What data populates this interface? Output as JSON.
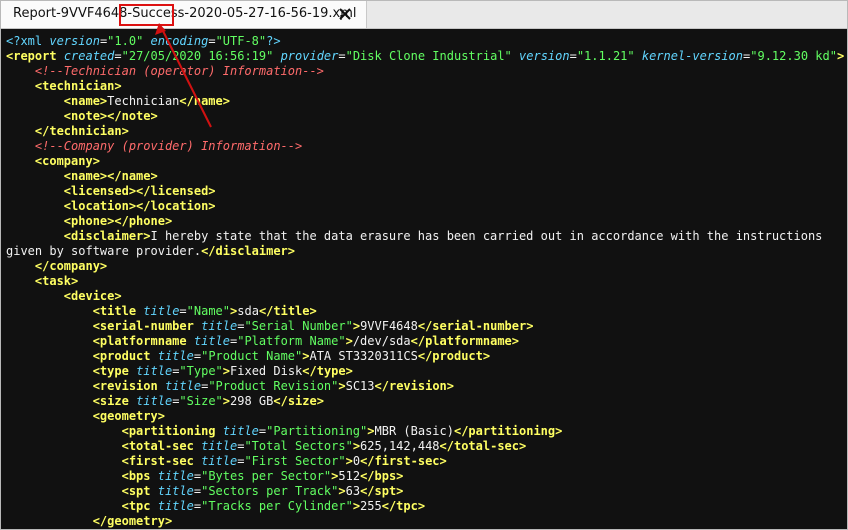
{
  "tab": {
    "title": "Report-9VVF4648-Success-2020-05-27-16-56-19.xml"
  },
  "editor": {
    "l1": {
      "open": "<?xml",
      "a1": "version",
      "v1": "\"1.0\"",
      "a2": "encoding",
      "v2": "\"UTF-8\"",
      "close": "?>"
    },
    "l2": {
      "open": "<report",
      "a1": "created",
      "v1": "\"27/05/2020 16:56:19\"",
      "a2": "provider",
      "v2": "\"Disk Clone Industrial\"",
      "a3": "version",
      "v3": "\"1.1.21\"",
      "a4": "kernel-version",
      "v4": "\"9.12.30 kd\"",
      "close": ">"
    },
    "l3": {
      "comment": "<!--Technician (operator) Information-->"
    },
    "l4": {
      "tag": "<technician>"
    },
    "l5": {
      "open": "<name>",
      "text": "Technician",
      "close": "</name>"
    },
    "l6": {
      "open": "<note>",
      "close": "</note>"
    },
    "l7": {
      "tag": "</technician>"
    },
    "l8": {
      "comment": "<!--Company (provider) Information-->"
    },
    "l9": {
      "tag": "<company>"
    },
    "l10": {
      "open": "<name>",
      "close": "</name>"
    },
    "l11": {
      "open": "<licensed>",
      "close": "</licensed>"
    },
    "l12": {
      "open": "<location>",
      "close": "</location>"
    },
    "l13": {
      "open": "<phone>",
      "close": "</phone>"
    },
    "l14": {
      "open": "<disclaimer>",
      "text": "I hereby state that the data erasure has been carried out in accordance with the instructions"
    },
    "l15": {
      "text": "given by software provider.",
      "close": "</disclaimer>"
    },
    "l16": {
      "tag": "</company>"
    },
    "l17": {
      "tag": "<task>"
    },
    "l18": {
      "tag": "<device>"
    },
    "l19": {
      "open": "<title",
      "attr": "title",
      "val": "\"Name\"",
      "gt": ">",
      "text": "sda",
      "close": "</title>"
    },
    "l20": {
      "open": "<serial-number",
      "attr": "title",
      "val": "\"Serial Number\"",
      "gt": ">",
      "text": "9VVF4648",
      "close": "</serial-number>"
    },
    "l21": {
      "open": "<platformname",
      "attr": "title",
      "val": "\"Platform Name\"",
      "gt": ">",
      "text": "/dev/sda",
      "close": "</platformname>"
    },
    "l22": {
      "open": "<product",
      "attr": "title",
      "val": "\"Product Name\"",
      "gt": ">",
      "text": "ATA ST3320311CS",
      "close": "</product>"
    },
    "l23": {
      "open": "<type",
      "attr": "title",
      "val": "\"Type\"",
      "gt": ">",
      "text": "Fixed Disk",
      "close": "</type>"
    },
    "l24": {
      "open": "<revision",
      "attr": "title",
      "val": "\"Product Revision\"",
      "gt": ">",
      "text": "SC13",
      "close": "</revision>"
    },
    "l25": {
      "open": "<size",
      "attr": "title",
      "val": "\"Size\"",
      "gt": ">",
      "text": "298 GB",
      "close": "</size>"
    },
    "l26": {
      "tag": "<geometry>"
    },
    "l27": {
      "open": "<partitioning",
      "attr": "title",
      "val": "\"Partitioning\"",
      "gt": ">",
      "text": "MBR (Basic)",
      "close": "</partitioning>"
    },
    "l28": {
      "open": "<total-sec",
      "attr": "title",
      "val": "\"Total Sectors\"",
      "gt": ">",
      "text": "625,142,448",
      "close": "</total-sec>"
    },
    "l29": {
      "open": "<first-sec",
      "attr": "title",
      "val": "\"First Sector\"",
      "gt": ">",
      "text": "0",
      "close": "</first-sec>"
    },
    "l30": {
      "open": "<bps",
      "attr": "title",
      "val": "\"Bytes per Sector\"",
      "gt": ">",
      "text": "512",
      "close": "</bps>"
    },
    "l31": {
      "open": "<spt",
      "attr": "title",
      "val": "\"Sectors per Track\"",
      "gt": ">",
      "text": "63",
      "close": "</spt>"
    },
    "l32": {
      "open": "<tpc",
      "attr": "title",
      "val": "\"Tracks per Cylinder\"",
      "gt": ">",
      "text": "255",
      "close": "</tpc>"
    },
    "l33": {
      "tag": "</geometry>"
    }
  },
  "colors": {
    "tag": "#ffff62",
    "attribute": "#62d6ff",
    "value": "#62ff62",
    "comment": "#ff6b6b",
    "text": "#f2f2f2",
    "background": "#111111",
    "annotation": "#d11111"
  },
  "icons": {
    "tab_close": "close-tab-icon"
  }
}
